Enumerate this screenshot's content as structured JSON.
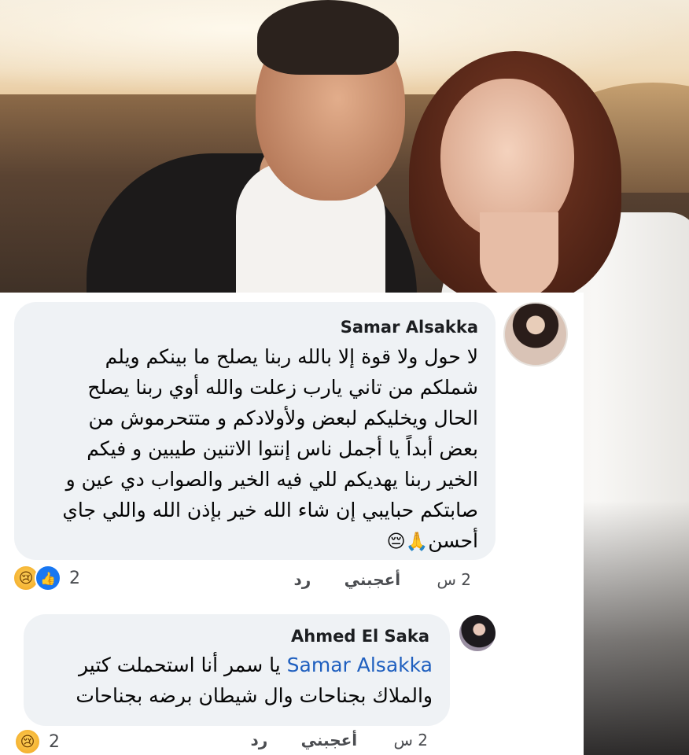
{
  "comments": [
    {
      "author": "Samar Alsakka",
      "lines": [
        "لا حول ولا قوة إلا بالله ربنا يصلح ما بينكم ويلم",
        "شملكم من تاني يارب زعلت والله أوي ربنا يصلح",
        "الحال ويخليكم لبعض ولأولادكم و متتحرموش من",
        "بعض أبداً يا أجمل ناس إنتوا الاتنين طيبين و فيكم",
        "الخير ربنا يهديكم للي فيه الخير والصواب دي عين و",
        "صابتكم حبايبي إن شاء الله خير بإذن الله واللي جاي",
        "أحسن"
      ],
      "trailing_emojis": "🙏😔",
      "time": "2 س",
      "like_label": "أعجبني",
      "reply_label": "رد",
      "reaction_count": "2",
      "reactions": [
        "sad-reaction",
        "like-reaction"
      ]
    },
    {
      "author": "Ahmed El Saka",
      "mention": "Samar Alsakka",
      "line1_rest": "يا سمر أنا استحملت كتير",
      "line2": "والملاك بجناحات وال شيطان برضه بجناحات",
      "time": "2 س",
      "like_label": "أعجبني",
      "reply_label": "رد",
      "reaction_count": "2",
      "reactions": [
        "sad-reaction"
      ]
    }
  ],
  "icons": {
    "sad": "😢",
    "like": "👍"
  },
  "colors": {
    "bubble": "#eff2f5",
    "mention": "#1f5fbf",
    "like_blue": "#1877f2"
  }
}
